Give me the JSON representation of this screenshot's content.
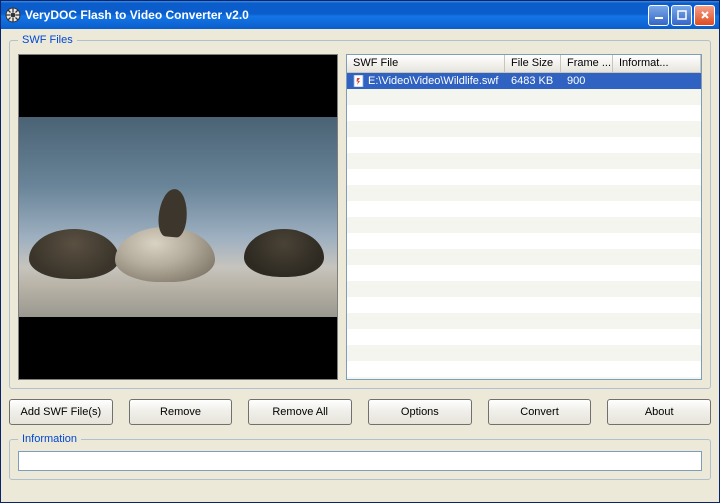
{
  "window": {
    "title": "VeryDOC Flash to Video Converter v2.0"
  },
  "swf_group": {
    "legend": "SWF Files",
    "columns": {
      "file": "SWF File",
      "size": "File Size",
      "frame": "Frame ...",
      "info": "Informat..."
    },
    "rows": [
      {
        "file": "E:\\Video\\Video\\Wildlife.swf",
        "size": "6483 KB",
        "frame": "900",
        "info": ""
      }
    ]
  },
  "buttons": {
    "add": "Add SWF File(s)",
    "remove": "Remove",
    "remove_all": "Remove All",
    "options": "Options",
    "convert": "Convert",
    "about": "About"
  },
  "info_group": {
    "legend": "Information",
    "value": ""
  },
  "icons": {
    "app": "app-icon",
    "file": "flash-file-icon"
  }
}
